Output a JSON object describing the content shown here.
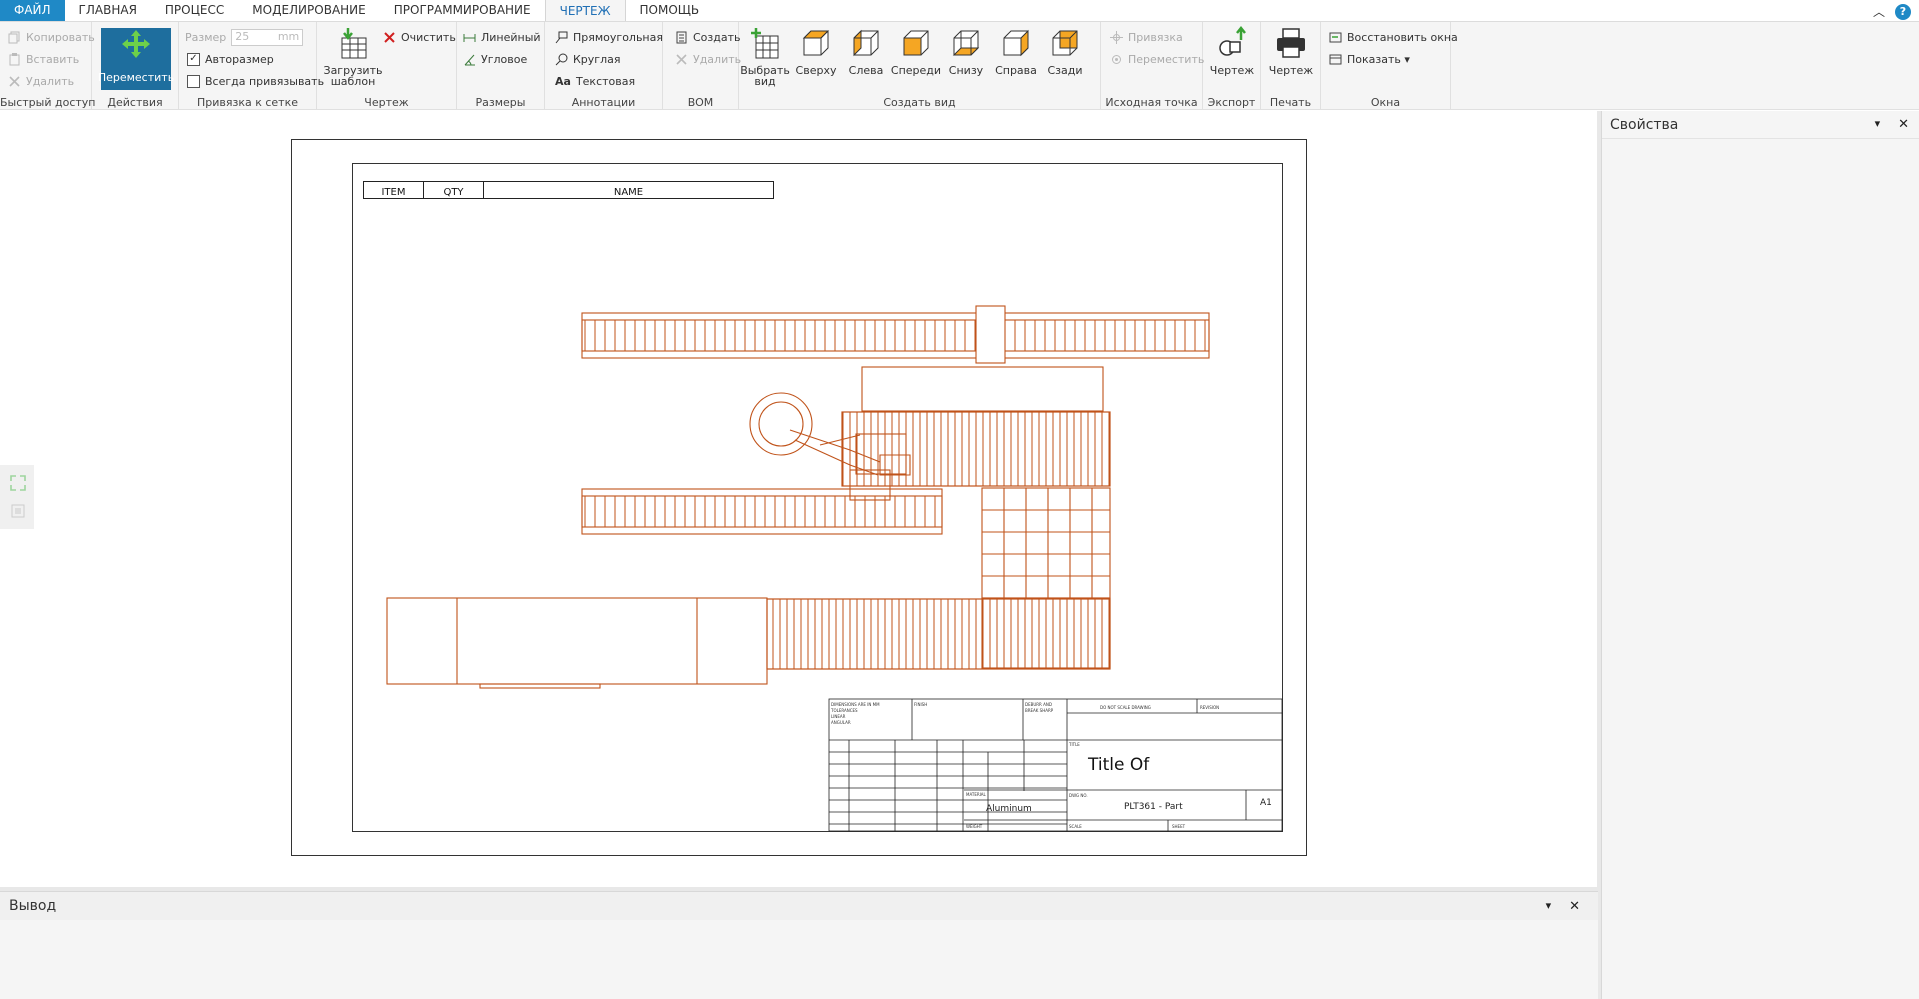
{
  "menu": {
    "tabs": [
      "ФАЙЛ",
      "ГЛАВНАЯ",
      "ПРОЦЕСС",
      "МОДЕЛИРОВАНИЕ",
      "ПРОГРАММИРОВАНИЕ",
      "ЧЕРТЕЖ",
      "ПОМОЩЬ"
    ],
    "active": "ЧЕРТЕЖ",
    "help": "?"
  },
  "ribbon": {
    "quick": {
      "copy": "Копировать",
      "paste": "Вставить",
      "delete": "Удалить",
      "label": "Быстрый доступ"
    },
    "actions": {
      "move": "Переместить",
      "label": "Действия"
    },
    "grid": {
      "size_label": "Размер",
      "size_value": "25",
      "size_unit": "mm",
      "autosize": "Авторазмер",
      "always": "Всегда привязывать",
      "label": "Привязка к сетке"
    },
    "drawing": {
      "load": "Загрузить шаблон",
      "load_line1": "Загрузить",
      "load_line2": "шаблон",
      "clear": "Очистить",
      "label": "Чертеж"
    },
    "dims": {
      "linear": "Линейный",
      "angular": "Угловое",
      "label": "Размеры"
    },
    "annot": {
      "rect": "Прямоугольная",
      "round": "Круглая",
      "text": "Текстовая",
      "label": "Аннотации",
      "text_icon": "Aa"
    },
    "bom": {
      "create": "Создать",
      "delete": "Удалить",
      "label": "BOM"
    },
    "view": {
      "pick": "Выбрать вид",
      "pick_line1": "Выбрать",
      "pick_line2": "вид",
      "top": "Сверху",
      "left": "Слева",
      "front": "Спереди",
      "bottom": "Снизу",
      "right": "Справа",
      "back": "Сзади",
      "label": "Создать вид"
    },
    "origin": {
      "snap": "Привязка",
      "move": "Переместить",
      "label": "Исходная точка"
    },
    "export": {
      "drawing": "Чертеж",
      "label": "Экспорт"
    },
    "print": {
      "drawing": "Чертеж",
      "label": "Печать"
    },
    "windows": {
      "restore": "Восстановить окна",
      "show": "Показать ▾",
      "label": "Окна"
    }
  },
  "sheet": {
    "bom_headers": [
      "ITEM",
      "QTY",
      "NAME"
    ],
    "title": "Title Of",
    "material": "Aluminum",
    "part": "PLT361 - Part",
    "size": "A1"
  },
  "panels": {
    "properties": "Свойства",
    "output": "Вывод",
    "pin": "📌",
    "close": "✕"
  },
  "colors": {
    "accent": "#1f89c6",
    "move_button": "#1e6e9e",
    "drawing": "#c0531a",
    "cube_face": "#f5a623"
  }
}
